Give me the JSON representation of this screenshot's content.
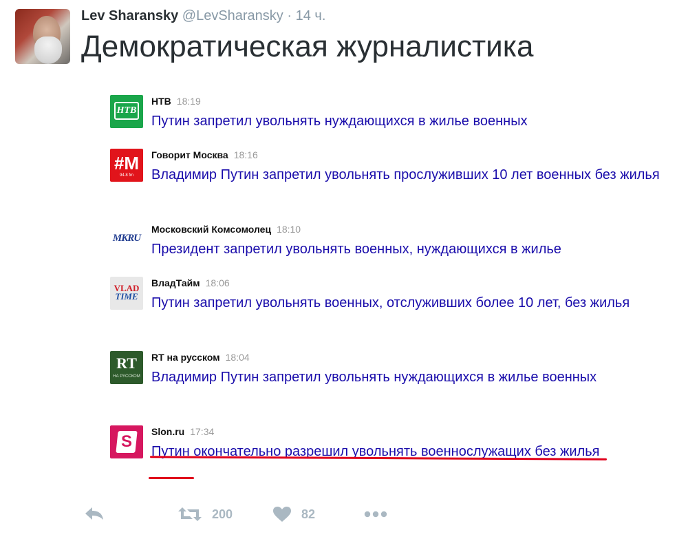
{
  "tweet": {
    "author_name": "Lev Sharansky",
    "author_handle": "@LevSharansky",
    "dot": "·",
    "time": "14 ч.",
    "text": "Демократическая журналистика"
  },
  "news": [
    {
      "source": "НТВ",
      "time": "18:19",
      "headline": "Путин запретил увольнять нуждающихся в жилье военных",
      "logo_text": "НТВ",
      "logo_color": "#1aa64a"
    },
    {
      "source": "Говорит Москва",
      "time": "18:16",
      "headline": "Владимир Путин запретил увольнять прослуживших 10 лет военных без жилья",
      "logo_text": "#M",
      "logo_sub": "94.8 fm",
      "logo_color": "#e1141b"
    },
    {
      "source": "Московский Комсомолец",
      "time": "18:10",
      "headline": "Президент запретил увольнять военных, нуждающихся в жилье",
      "logo_text": "MKRU",
      "logo_color": "#ffffff"
    },
    {
      "source": "ВладТайм",
      "time": "18:06",
      "headline": "Путин запретил увольнять военных, отслуживших более 10 лет, без жилья",
      "logo_text": "VLAD",
      "logo_text2": "TIME",
      "logo_color": "#e8e8e8"
    },
    {
      "source": "RT на русском",
      "time": "18:04",
      "headline": "Владимир Путин запретил увольнять нуждающихся в жилье военных",
      "logo_text": "RT",
      "logo_sub": "НА РУССКОМ",
      "logo_color": "#2d5a2b"
    },
    {
      "source": "Slon.ru",
      "time": "17:34",
      "headline": "Путин окончательно разрешил увольнять военнослужащих без жилья",
      "logo_text": "S",
      "logo_color": "#d6175f"
    }
  ],
  "actions": {
    "retweets": "200",
    "likes": "82"
  },
  "colors": {
    "headline": "#1a0dab",
    "underline": "#e0001b",
    "action_gray": "#aab8c2"
  }
}
